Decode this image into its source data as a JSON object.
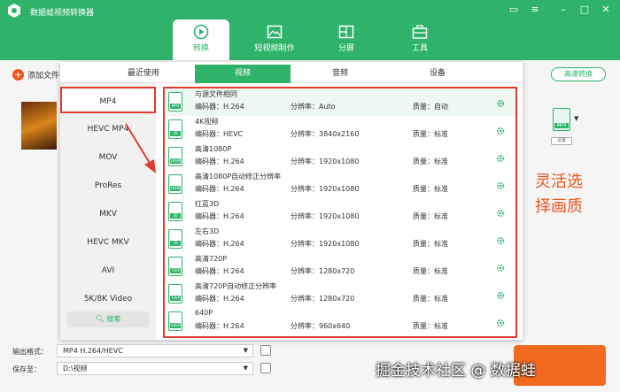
{
  "app": {
    "title": "数据蛙视频转换器"
  },
  "nav": [
    {
      "label": "转换"
    },
    {
      "label": "短视频制作"
    },
    {
      "label": "分屏"
    },
    {
      "label": "工具"
    }
  ],
  "toolbar": {
    "add_file_label": "添加文件",
    "fast_convert_label": "高速转换"
  },
  "output_format": {
    "icon_label": "MP4",
    "settings_label": "设置"
  },
  "dialog": {
    "tabs": [
      "最近使用",
      "视频",
      "音频",
      "设备"
    ],
    "active_tab": "视频",
    "formats": [
      "MP4",
      "HEVC MP4",
      "MOV",
      "ProRes",
      "MKV",
      "HEVC MKV",
      "AVI",
      "5K/8K Video"
    ],
    "active_format": "MP4",
    "search_label": "搜索",
    "presets": [
      {
        "name": "与源文件相同",
        "codec": "编码器：H.264",
        "resolution": "分辨率：Auto",
        "quality": "质量：自动",
        "badge": "MP4"
      },
      {
        "name": "4K视频",
        "codec": "编码器：HEVC",
        "resolution": "分辨率：3840x2160",
        "quality": "质量：标准",
        "badge": "4K"
      },
      {
        "name": "高清1080P",
        "codec": "编码器：H.264",
        "resolution": "分辨率：1920x1080",
        "quality": "质量：标准",
        "badge": "1080P"
      },
      {
        "name": "高清1080P自动修正分辨率",
        "codec": "编码器：H.264",
        "resolution": "分辨率：1920x1080",
        "quality": "质量：标准",
        "badge": "1080P"
      },
      {
        "name": "红蓝3D",
        "codec": "编码器：H.264",
        "resolution": "分辨率：1920x1080",
        "quality": "质量：标准",
        "badge": "3D"
      },
      {
        "name": "左右3D",
        "codec": "编码器：H.264",
        "resolution": "分辨率：1920x1080",
        "quality": "质量：标准",
        "badge": "3D"
      },
      {
        "name": "高清720P",
        "codec": "编码器：H.264",
        "resolution": "分辨率：1280x720",
        "quality": "质量：标准",
        "badge": "720P"
      },
      {
        "name": "高清720P自动修正分辨率",
        "codec": "编码器：H.264",
        "resolution": "分辨率：1280x720",
        "quality": "质量：标准",
        "badge": "720P"
      },
      {
        "name": "640P",
        "codec": "编码器：H.264",
        "resolution": "分辨率：960x640",
        "quality": "质量：标准",
        "badge": "640P"
      }
    ]
  },
  "bottom": {
    "output_label": "输出格式：",
    "output_value": "MP4 H.264/HEVC",
    "save_label": "保存至：",
    "save_value": "D:\\视频"
  },
  "annotation": {
    "text": "灵活选择画质"
  },
  "watermark": {
    "text": "掘金技术社区 @ 数据蛙"
  },
  "colors": {
    "brand": "#2fb36a",
    "highlight": "#e23b2f",
    "accent": "#f26a1f"
  }
}
